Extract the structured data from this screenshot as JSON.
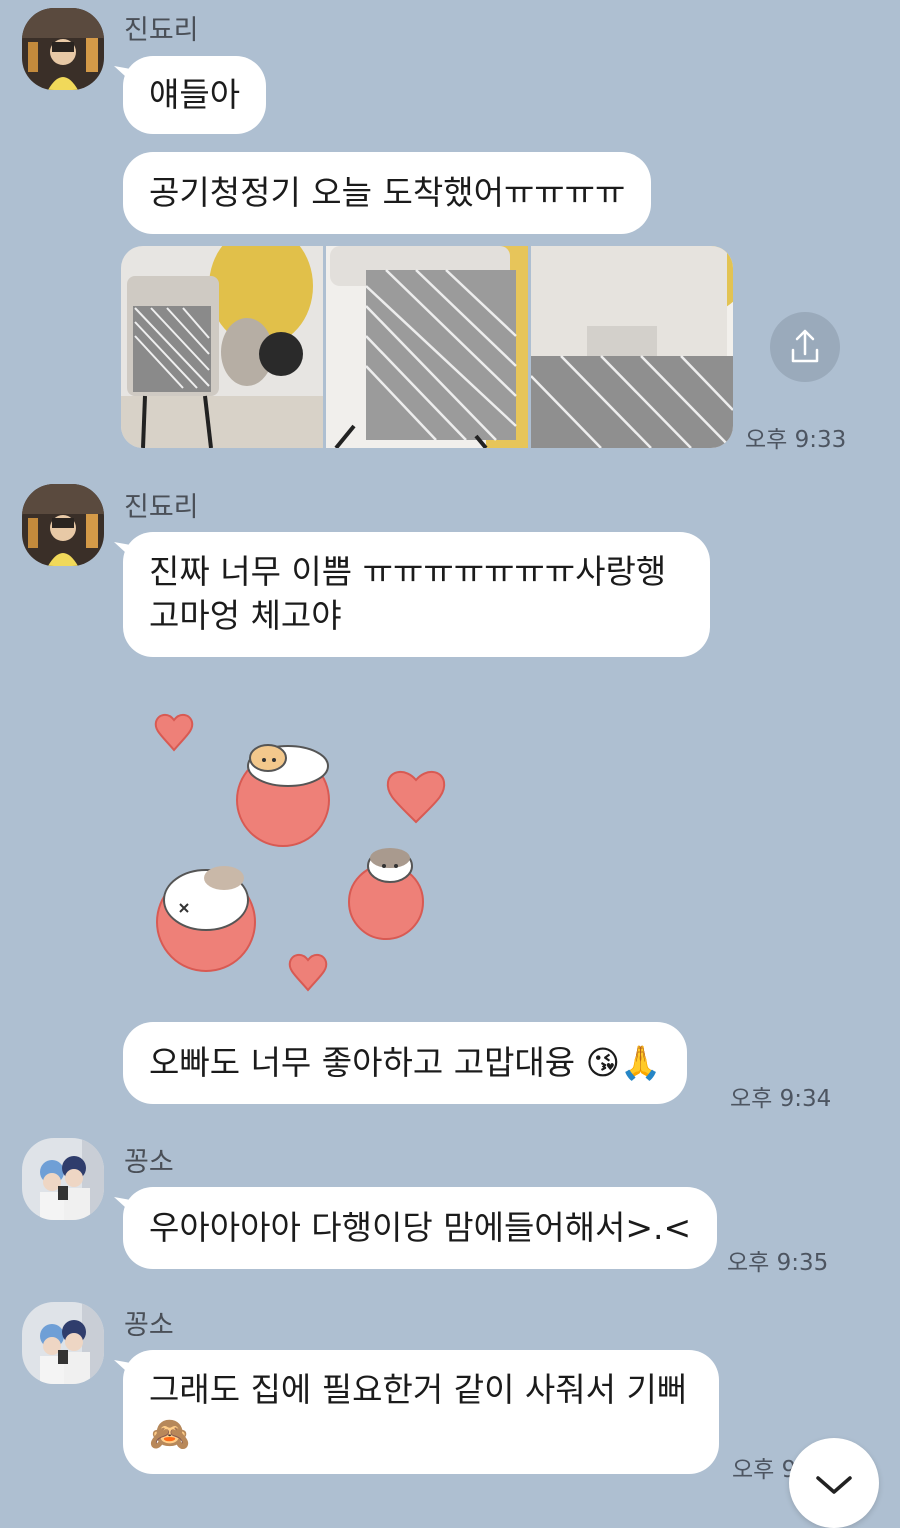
{
  "messages": [
    {
      "sender": "진됴리",
      "lines": [
        "얘들아"
      ]
    },
    {
      "lines": [
        "공기청정기 오늘 도착했어ㅠㅠㅠㅠ"
      ]
    },
    {
      "time": "오후 9:33"
    },
    {
      "sender": "진됴리",
      "lines": [
        "진짜 너무 이쁨 ㅠㅠㅠㅠㅠㅠㅠ사랑행",
        "고마엉 체고야"
      ]
    },
    {
      "lines": [
        "오빠도 너무 좋아하고 고맙대융 😘🙏"
      ],
      "time": "오후 9:34"
    },
    {
      "sender": "꽁소",
      "lines": [
        "우아아아아 다행이당 맘에들어해서>.<"
      ],
      "time": "오후 9:35"
    },
    {
      "sender": "꽁소",
      "lines": [
        "그래도 집에 필요한거 같이 사줘서 기뻐",
        "🙈"
      ],
      "time": "오후 9:36"
    }
  ],
  "icons": {
    "share": "share-icon",
    "scroll_down": "chevron-down-icon"
  }
}
